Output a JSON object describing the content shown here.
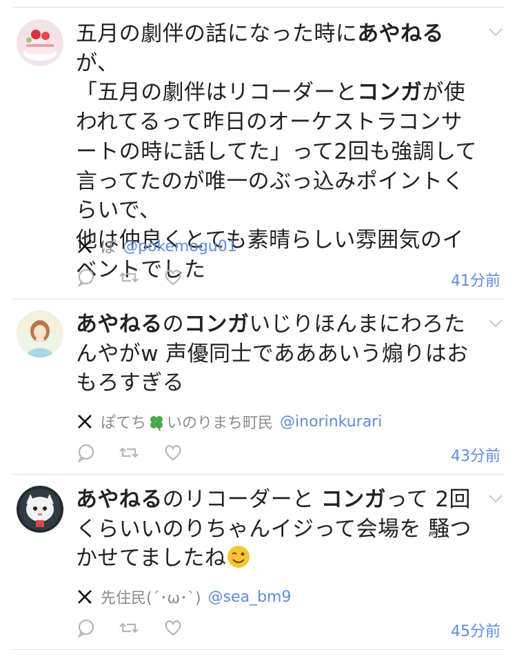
{
  "posts": [
    {
      "text": [
        {
          "t": "五月の劇伴の話になった時に"
        },
        {
          "t": "あやねる",
          "b": true
        },
        {
          "t": "が、\n「五月の劇伴はリコーダーと"
        },
        {
          "t": "コンガ",
          "b": true
        },
        {
          "t": "が使われてるって昨日のオーケストラコンサートの時に話してた」って2回も強調して言ってたのが唯一のぶっ込みポイントくらいで、\n他は仲良くとても素晴らしい雰囲気のイベントでした"
        }
      ],
      "user_name": "ぽ",
      "handle": "@pokemogu01",
      "time": "41分前",
      "avatar_icon": "cake-avatar-icon"
    },
    {
      "text": [
        {
          "t": "あやねる",
          "b": true
        },
        {
          "t": "の"
        },
        {
          "t": "コンガ",
          "b": true
        },
        {
          "t": "いじりほんまにわろたんやがw 声優同士であああいう煽りはおもろすぎる"
        }
      ],
      "user_name_before": "ぽてち",
      "user_name_after": "いのりまち町民",
      "handle": "@inorinkurari",
      "time": "43分前",
      "avatar_icon": "girl-avatar-icon"
    },
    {
      "text": [
        {
          "t": "あやねる",
          "b": true
        },
        {
          "t": "のリコーダーと "
        },
        {
          "t": "コンガ",
          "b": true
        },
        {
          "t": "って 2回くらいいのりちゃんイジって会場を 騒つかせてましたね"
        }
      ],
      "user_name": "先住民(´･ω･`)",
      "handle": "@sea_bm9",
      "time": "45分前",
      "avatar_icon": "character-avatar-icon"
    }
  ],
  "colors": {
    "link": "#5b8ed8",
    "text": "#222222",
    "muted": "#8b8b8b",
    "divider": "#e3e3e3"
  }
}
